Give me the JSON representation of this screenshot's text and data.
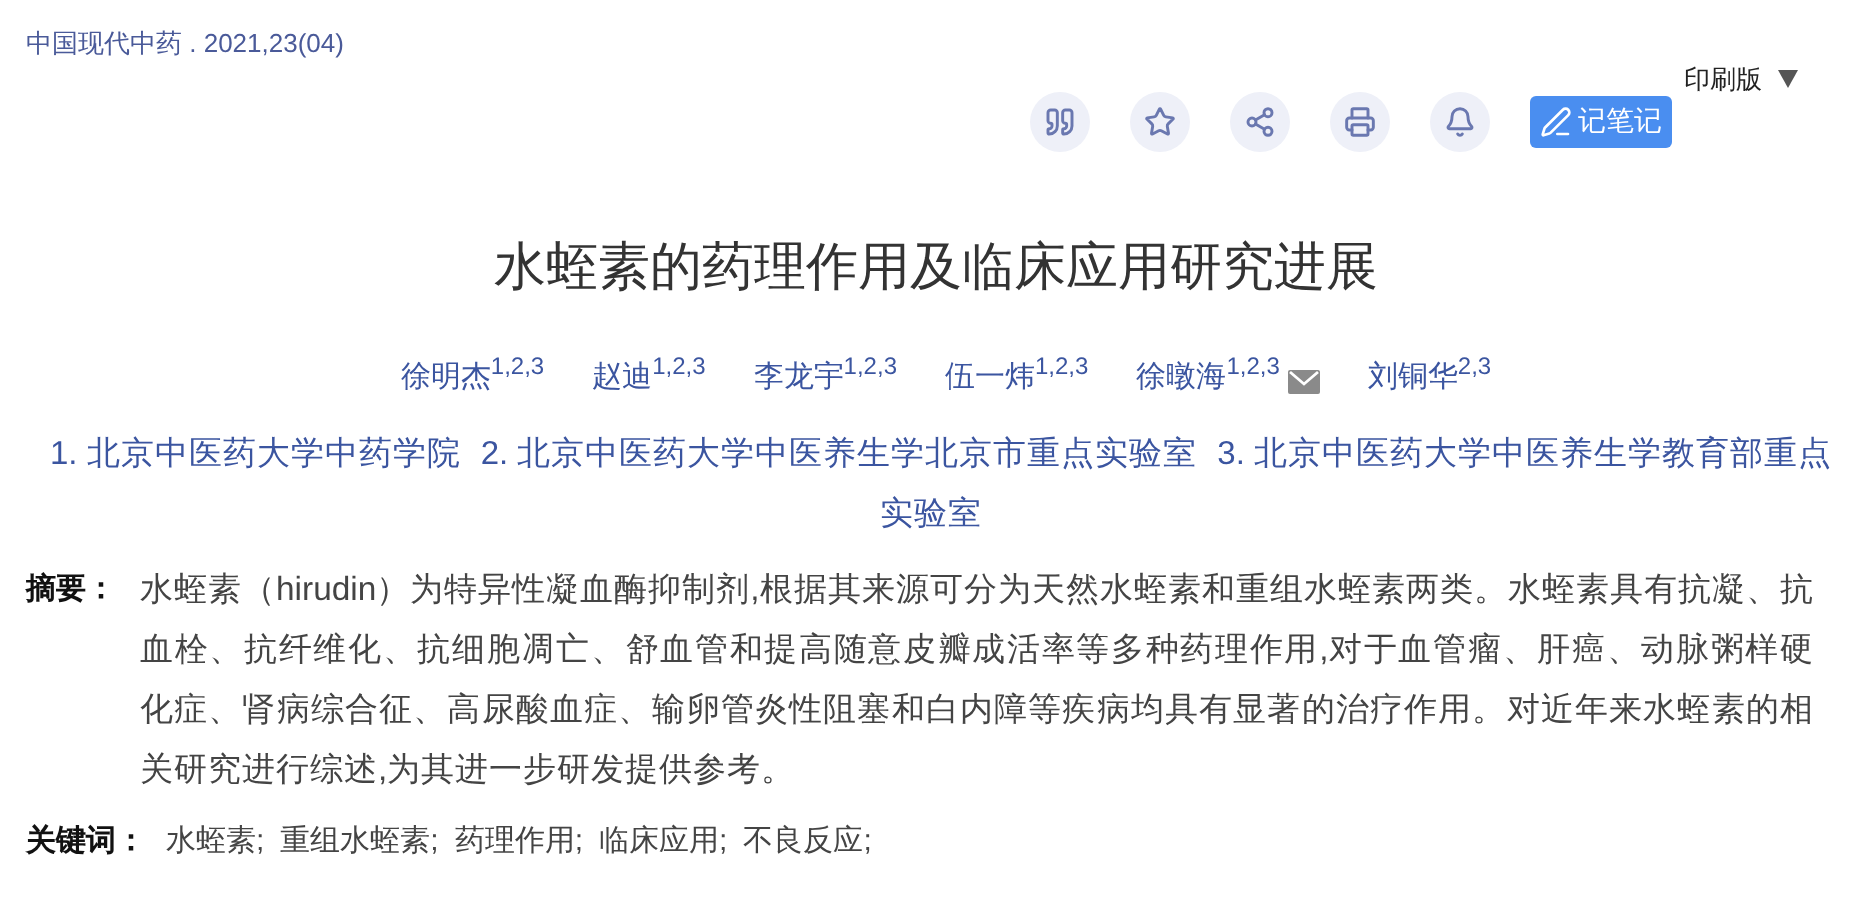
{
  "journal": "中国现代中药 . 2021,23(04)",
  "toolbar": {
    "icons": [
      {
        "kind": "quote"
      },
      {
        "kind": "star"
      },
      {
        "kind": "share"
      },
      {
        "kind": "print"
      },
      {
        "kind": "bell"
      }
    ],
    "note_button": "记笔记",
    "print_version": "印刷版"
  },
  "title": "水蛭素的药理作用及临床应用研究进展",
  "authors": [
    {
      "name": "徐明杰$^{1,2,3}$",
      "email": false
    },
    {
      "name": "赵迪$^{1,2,3}$",
      "email": false
    },
    {
      "name": "李龙宇$^{1,2,3}$",
      "email": false
    },
    {
      "name": "伍一炜$^{1,2,3}$",
      "email": false
    },
    {
      "name": "徐暾海$^{1,2,3}$",
      "email": true
    },
    {
      "name": "刘铜华$^{2,3}$",
      "email": false
    }
  ],
  "affiliations": [
    "1. 北京中医药大学中药学院",
    "2. 北京中医药大学中医养生学北京市重点实验室",
    "3. 北京中医药大学中医养生学教育部重点实验室"
  ],
  "abstract": {
    "label": "摘要：",
    "text": "水蛭素（hirudin）为特异性凝血酶抑制剂,根据其来源可分为天然水蛭素和重组水蛭素两类。水蛭素具有抗凝、抗血栓、抗纤维化、抗细胞凋亡、舒血管和提高随意皮瓣成活率等多种药理作用,对于血管瘤、肝癌、动脉粥样硬化症、肾病综合征、高尿酸血症、输卵管炎性阻塞和白内障等疾病均具有显著的治疗作用。对近年来水蛭素的相关研究进行综述,为其进一步研发提供参考。"
  },
  "keywords": {
    "label": "关键词：",
    "items": [
      "水蛭素;",
      "重组水蛭素;",
      "药理作用;",
      "临床应用;",
      "不良反应;"
    ]
  }
}
